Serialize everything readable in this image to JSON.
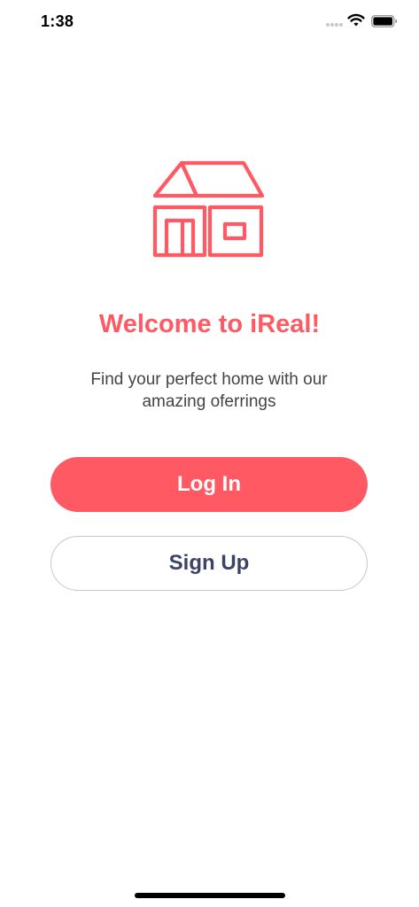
{
  "status_bar": {
    "time": "1:38",
    "icons": [
      "signal-dots-icon",
      "wifi-icon",
      "battery-icon"
    ]
  },
  "welcome": {
    "logo_icon": "house-icon",
    "title": "Welcome to iReal!",
    "subtitle": "Find your perfect home with our amazing oferrings"
  },
  "actions": {
    "login_label": "Log In",
    "signup_label": "Sign Up"
  },
  "colors": {
    "accent": "#ff5a64",
    "secondary_text": "#3d4366",
    "body_text": "#444444",
    "outline": "#c5c5d2"
  }
}
